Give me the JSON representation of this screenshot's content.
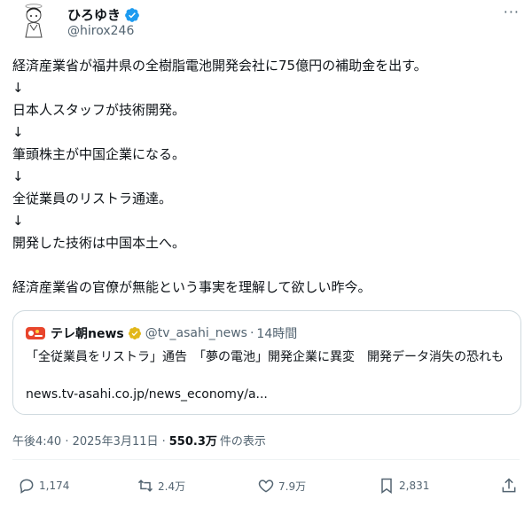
{
  "tweet": {
    "author_name": "ひろゆき",
    "author_handle": "@hirox246",
    "more_label": "···",
    "lines": [
      "経済産業省が福井県の全樹脂電池開発会社に75億円の補助金を出す。",
      "↓",
      "日本人スタッフが技術開発。",
      "↓",
      "筆頭株主が中国企業になる。",
      "↓",
      "全従業員のリストラ通達。",
      "↓",
      "開発した技術は中国本土へ。",
      "",
      "経済産業省の官僚が無能という事実を理解して欲しい昨今。"
    ]
  },
  "quote": {
    "source_name": "テレ朝news",
    "source_handle": "@tv_asahi_news",
    "separator": "·",
    "time": "14時間",
    "text": "「全従業員をリストラ」通告　「夢の電池」開発企業に異変　開発データ消失の恐れも",
    "link": "news.tv-asahi.co.jp/news_economy/a..."
  },
  "meta": {
    "time": "午後4:40 · 2025年3月11日 ·",
    "views": "550.3万",
    "views_label": "件の表示"
  },
  "actions": {
    "reply_count": "1,174",
    "repost_count": "2.4万",
    "like_count": "7.9万",
    "bookmark_count": "2,831"
  },
  "colors": {
    "text": "#0f1419",
    "secondary": "#536471",
    "verified_blue": "#1d9bf0",
    "verified_gold": "#e2b719",
    "border": "#cfd9de"
  }
}
